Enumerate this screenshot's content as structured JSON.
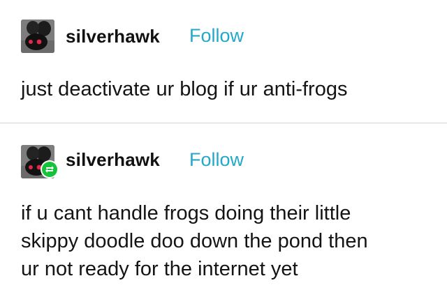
{
  "posts": [
    {
      "username": "silverhawk",
      "follow_label": "Follow",
      "avatar_icon": "moth-avatar-icon",
      "body": [
        "just deactivate ur blog if ur anti-frogs"
      ]
    },
    {
      "username": "silverhawk",
      "follow_label": "Follow",
      "avatar_icon": "moth-avatar-icon",
      "badge_icon": "reblog-icon",
      "body": [
        "if u cant handle frogs doing their little",
        "skippy doodle doo down the pond then",
        "ur not ready for the internet yet"
      ]
    }
  ],
  "colors": {
    "follow": "#24a8c9",
    "reblog_badge": "#16c23b",
    "divider": "#d2d2d2",
    "avatar_eyes": "#e0284a"
  }
}
